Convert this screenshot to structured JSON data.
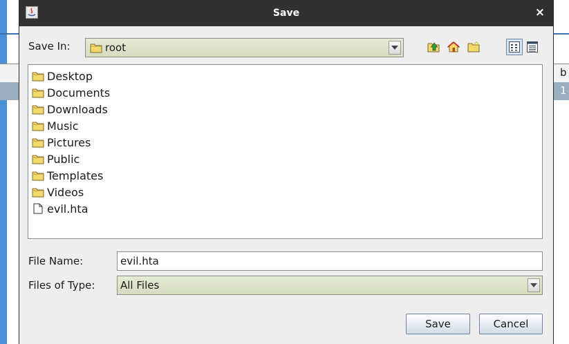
{
  "dialog": {
    "title": "Save",
    "close_symbol": "×",
    "app_icon": "java-app-icon",
    "close_icon": "close-icon"
  },
  "background_app": {
    "column_header_text": "b",
    "selected_cell_text": "1"
  },
  "save_in": {
    "label": "Save In:",
    "value": "root",
    "icon": "folder-icon"
  },
  "toolbar": {
    "buttons": [
      {
        "name": "up-one-level-icon"
      },
      {
        "name": "home-icon"
      },
      {
        "name": "new-folder-icon"
      },
      {
        "name": "list-view-icon",
        "active": true
      },
      {
        "name": "details-view-icon",
        "active": false
      }
    ]
  },
  "files": [
    {
      "name": "Desktop",
      "type": "folder"
    },
    {
      "name": "Documents",
      "type": "folder"
    },
    {
      "name": "Downloads",
      "type": "folder"
    },
    {
      "name": "Music",
      "type": "folder"
    },
    {
      "name": "Pictures",
      "type": "folder"
    },
    {
      "name": "Public",
      "type": "folder"
    },
    {
      "name": "Templates",
      "type": "folder"
    },
    {
      "name": "Videos",
      "type": "folder"
    },
    {
      "name": "evil.hta",
      "type": "file"
    }
  ],
  "file_name": {
    "label": "File Name:",
    "value": "evil.hta"
  },
  "files_of_type": {
    "label": "Files of Type:",
    "value": "All Files"
  },
  "buttons": {
    "save": "Save",
    "cancel": "Cancel"
  },
  "colors": {
    "titlebar": "#313131",
    "combo_fill": "#dfe5cb",
    "folder_fill": "#f5d86a",
    "folder_stroke": "#7a6a2a",
    "selection": "#9aaebf",
    "accent_blue": "#4a90d9"
  }
}
